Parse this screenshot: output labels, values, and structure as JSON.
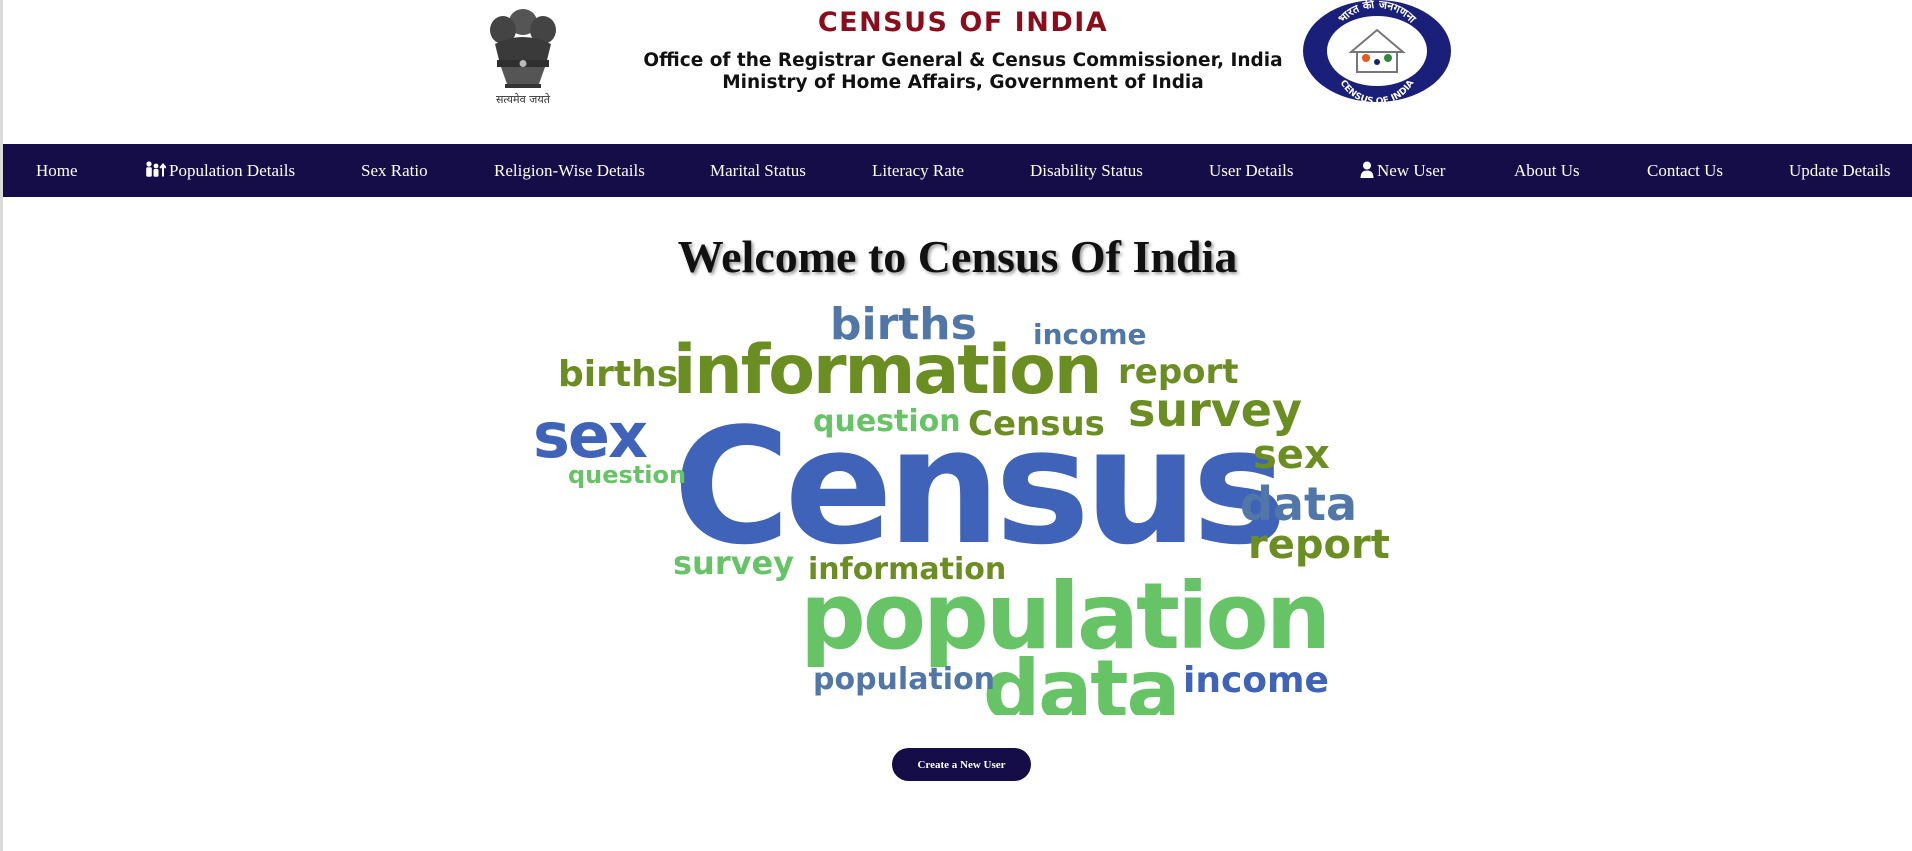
{
  "header": {
    "emblem_motto": "सत्यमेव जयते",
    "title": "CENSUS OF INDIA",
    "subtitle_line1": "Office of the Registrar General & Census Commissioner, India",
    "subtitle_line2": "Ministry of Home Affairs, Government of India",
    "logo_text_top": "भारत की जनगणना",
    "logo_text_bottom": "CENSUS OF INDIA"
  },
  "nav": {
    "items": [
      {
        "label": "Home",
        "icon": ""
      },
      {
        "label": "Population Details",
        "icon": "people-up-icon"
      },
      {
        "label": "Sex Ratio",
        "icon": ""
      },
      {
        "label": "Religion-Wise Details",
        "icon": ""
      },
      {
        "label": "Marital Status",
        "icon": ""
      },
      {
        "label": "Literacy Rate",
        "icon": ""
      },
      {
        "label": "Disability Status",
        "icon": ""
      },
      {
        "label": "User Details",
        "icon": ""
      },
      {
        "label": "New User",
        "icon": "user-icon"
      },
      {
        "label": "About Us",
        "icon": ""
      },
      {
        "label": "Contact Us",
        "icon": ""
      },
      {
        "label": "Update Details",
        "icon": ""
      }
    ]
  },
  "main": {
    "welcome": "Welcome to Census Of India",
    "create_button": "Create a New User"
  },
  "word_cloud": {
    "words": [
      "Census",
      "population",
      "data",
      "information",
      "sex",
      "survey",
      "births",
      "report",
      "income",
      "question",
      "Census",
      "data",
      "survey",
      "report",
      "sex",
      "births",
      "income",
      "question",
      "information",
      "population"
    ]
  },
  "colors": {
    "nav_bg": "#150d47",
    "title_red": "#8b0d1c",
    "cloud_blue": "#3f63b8",
    "cloud_olive": "#6b8e23",
    "cloud_green": "#66c466"
  }
}
